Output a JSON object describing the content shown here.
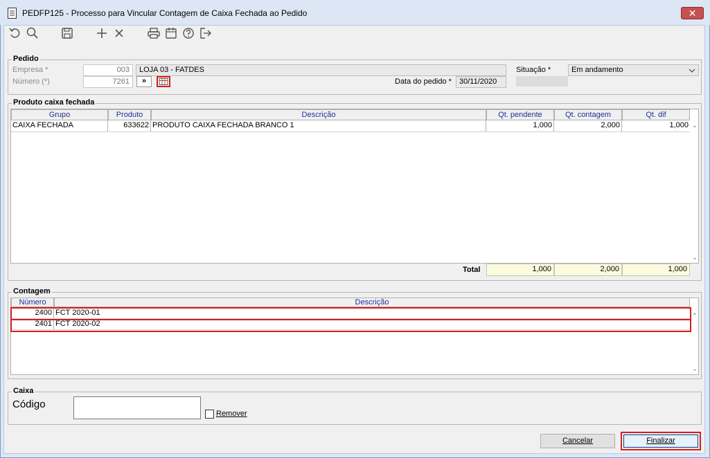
{
  "window": {
    "title": "PEDFP125 - Processo para Vincular Contagem de Caixa Fechada ao Pedido",
    "close_glyph": "✕"
  },
  "toolbar": [
    "refresh-icon",
    "search-icon",
    "save-icon",
    "add-icon",
    "delete-icon",
    "print-icon",
    "calendar-icon",
    "help-icon",
    "exit-icon"
  ],
  "pedido": {
    "title": "Pedido",
    "empresa_label": "Empresa *",
    "empresa_code": "003",
    "empresa_name": "LOJA 03 - FATDES",
    "numero_label": "Número (*)",
    "numero_value": "7261",
    "goto_button": "»",
    "situacao_label": "Situação *",
    "situacao_value": "Em andamento",
    "data_label": "Data do pedido *",
    "data_value": "30/11/2020"
  },
  "produto": {
    "title": "Produto caixa fechada",
    "columns": [
      "Grupo",
      "Produto",
      "Descrição",
      "Qt. pendente",
      "Qt. contagem",
      "Qt. dif"
    ],
    "rows": [
      [
        "CAIXA FECHADA",
        "633622",
        "PRODUTO CAIXA FECHADA BRANCO 1",
        "1,000",
        "2,000",
        "1,000"
      ]
    ],
    "total_label": "Total",
    "totals": [
      "1,000",
      "2,000",
      "1,000"
    ]
  },
  "contagem": {
    "title": "Contagem",
    "columns": [
      "Número",
      "Descrição"
    ],
    "rows": [
      [
        "2400",
        "FCT 2020-01"
      ],
      [
        "2401",
        "FCT 2020-02"
      ]
    ]
  },
  "caixa": {
    "title": "Caixa",
    "codigo_label": "Código",
    "codigo_value": "",
    "remover_label": "Remover"
  },
  "buttons": {
    "cancelar": "Cancelar",
    "finalizar": "Finalizar"
  },
  "colors": {
    "highlight_red": "#d81c1c",
    "header_blue": "#1e2f99",
    "total_bg": "#fbfbe0"
  }
}
